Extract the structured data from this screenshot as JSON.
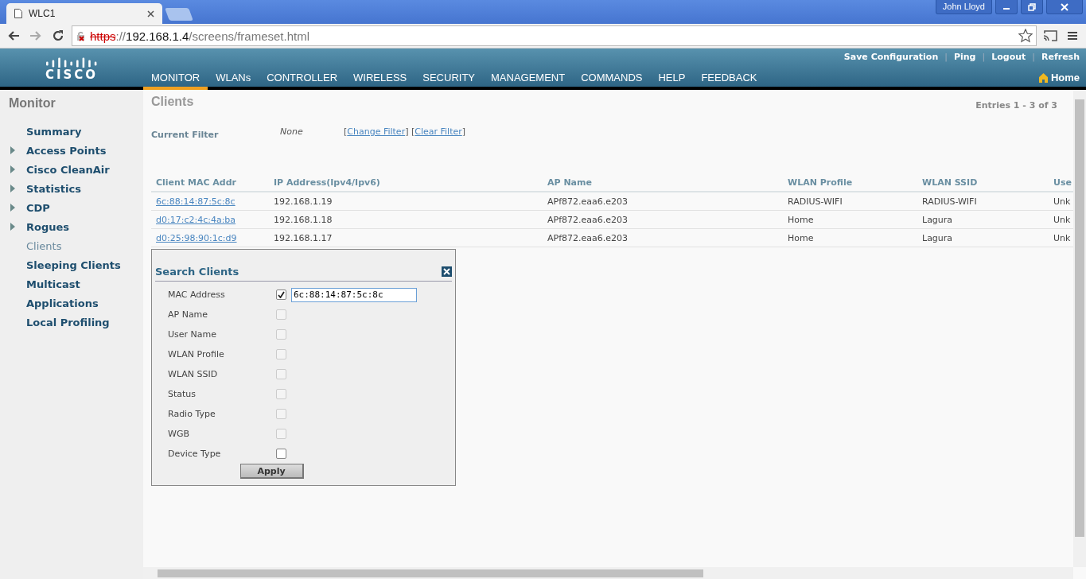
{
  "browser": {
    "tab_title": "WLC1",
    "url_scheme": "https",
    "url_rest": "://",
    "url_host": "192.168.1.4",
    "url_path": "/screens/frameset.html",
    "user": "John Lloyd"
  },
  "header": {
    "logo_text": "CISCO",
    "top_links": [
      "Save Configuration",
      "Ping",
      "Logout",
      "Refresh"
    ],
    "separator": "|",
    "nav": [
      {
        "label": "MONITOR",
        "selected": true
      },
      {
        "label": "WLANs",
        "selected": false
      },
      {
        "label": "CONTROLLER",
        "selected": false
      },
      {
        "label": "WIRELESS",
        "selected": false
      },
      {
        "label": "SECURITY",
        "selected": false
      },
      {
        "label": "MANAGEMENT",
        "selected": false
      },
      {
        "label": "COMMANDS",
        "selected": false
      },
      {
        "label": "HELP",
        "selected": false
      },
      {
        "label": "FEEDBACK",
        "selected": false
      }
    ],
    "home": "Home"
  },
  "sidebar": {
    "title": "Monitor",
    "items": [
      {
        "label": "Summary",
        "expandable": false,
        "selected": false
      },
      {
        "label": "Access Points",
        "expandable": true,
        "selected": false
      },
      {
        "label": "Cisco CleanAir",
        "expandable": true,
        "selected": false
      },
      {
        "label": "Statistics",
        "expandable": true,
        "selected": false
      },
      {
        "label": "CDP",
        "expandable": true,
        "selected": false
      },
      {
        "label": "Rogues",
        "expandable": true,
        "selected": false
      },
      {
        "label": "Clients",
        "expandable": false,
        "selected": true
      },
      {
        "label": "Sleeping Clients",
        "expandable": false,
        "selected": false
      },
      {
        "label": "Multicast",
        "expandable": false,
        "selected": false
      },
      {
        "label": "Applications",
        "expandable": false,
        "selected": false
      },
      {
        "label": "Local Profiling",
        "expandable": false,
        "selected": false
      }
    ]
  },
  "content": {
    "title": "Clients",
    "entries": "Entries 1 - 3 of 3",
    "filter_label": "Current Filter",
    "filter_value": "None",
    "bracket_open": "[",
    "bracket_close": "]",
    "filter_links": [
      "Change Filter",
      "Clear Filter"
    ],
    "table": {
      "columns": [
        "Client MAC Addr",
        "IP Address(Ipv4/Ipv6)",
        "AP Name",
        "WLAN Profile",
        "WLAN SSID",
        "Use"
      ],
      "rows": [
        [
          "6c:88:14:87:5c:8c",
          "192.168.1.19",
          "APf872.eaa6.e203",
          "RADIUS-WIFI",
          "RADIUS-WIFI",
          "Unk"
        ],
        [
          "d0:17:c2:4c:4a:ba",
          "192.168.1.18",
          "APf872.eaa6.e203",
          "Home",
          "Lagura",
          "Unk"
        ],
        [
          "d0:25:98:90:1c:d9",
          "192.168.1.17",
          "APf872.eaa6.e203",
          "Home",
          "Lagura",
          "Unk"
        ]
      ]
    }
  },
  "search_dialog": {
    "title": "Search Clients",
    "fields": [
      {
        "label": "MAC Address",
        "checked": true,
        "disabled": false,
        "value": "6c:88:14:87:5c:8c"
      },
      {
        "label": "AP Name",
        "checked": false,
        "disabled": true
      },
      {
        "label": "User Name",
        "checked": false,
        "disabled": true
      },
      {
        "label": "WLAN Profile",
        "checked": false,
        "disabled": true
      },
      {
        "label": "WLAN SSID",
        "checked": false,
        "disabled": true
      },
      {
        "label": "Status",
        "checked": false,
        "disabled": true
      },
      {
        "label": "Radio Type",
        "checked": false,
        "disabled": true
      },
      {
        "label": "WGB",
        "checked": false,
        "disabled": true
      },
      {
        "label": "Device Type",
        "checked": false,
        "disabled": false
      }
    ],
    "apply": "Apply"
  }
}
